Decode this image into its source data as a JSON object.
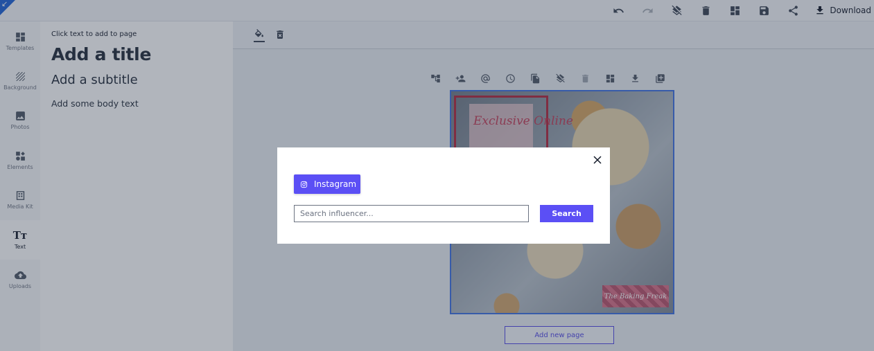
{
  "topbar": {
    "icons": [
      "undo-icon",
      "redo-icon",
      "layers-off-icon",
      "delete-icon",
      "layout-icon",
      "save-icon",
      "share-icon"
    ],
    "download_label": "Download"
  },
  "rail": {
    "items": [
      {
        "label": "Templates",
        "icon": "templates-icon"
      },
      {
        "label": "Background",
        "icon": "background-icon"
      },
      {
        "label": "Photos",
        "icon": "photos-icon"
      },
      {
        "label": "Elements",
        "icon": "elements-icon"
      },
      {
        "label": "Media Kit",
        "icon": "media-kit-icon"
      },
      {
        "label": "Text",
        "icon": "text-icon",
        "glyph": "Tт",
        "active": true
      },
      {
        "label": "Uploads",
        "icon": "uploads-icon"
      }
    ]
  },
  "panel": {
    "hint": "Click text to add to page",
    "title": "Add a title",
    "subtitle": "Add a subtitle",
    "body": "Add some body text"
  },
  "editor": {
    "toolbar_icons": [
      "fill-color-icon",
      "delete-icon"
    ],
    "page_tools": [
      "hierarchy-icon",
      "add-person-icon",
      "at-icon",
      "clock-icon",
      "copy-icon",
      "layers-off-icon",
      "delete-icon",
      "layout-icon",
      "download-icon",
      "add-page-icon"
    ],
    "design": {
      "script_text": "Exclusive Online",
      "brand_text": "The Baking Freak"
    },
    "add_page_label": "Add new page"
  },
  "modal": {
    "tab_label": "Instagram",
    "search_placeholder": "Search influencer...",
    "search_value": "",
    "search_button": "Search"
  },
  "colors": {
    "accent": "#5b4ff5",
    "page_border": "#3b6fe0"
  }
}
